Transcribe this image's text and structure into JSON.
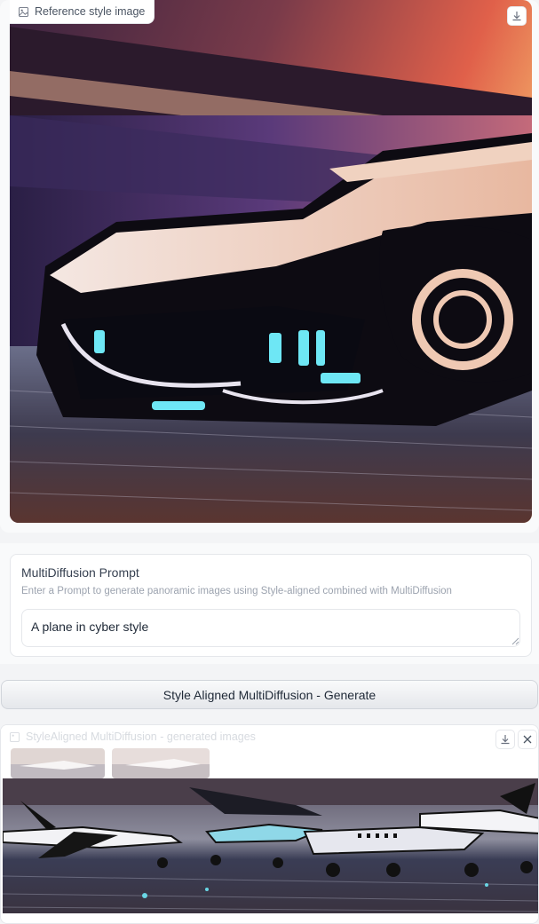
{
  "reference_image": {
    "label": "Reference style image",
    "download_icon": "download-icon"
  },
  "prompt": {
    "label": "MultiDiffusion Prompt",
    "info": "Enter a Prompt to generate panoramic images using Style-aligned combined with MultiDiffusion",
    "value": "A plane in cyber style"
  },
  "generate_button": {
    "label": "Style Aligned MultiDiffusion - Generate"
  },
  "gallery": {
    "label": "StyleAligned MultiDiffusion - generated images",
    "download_icon": "download-icon",
    "close_icon": "close-icon"
  },
  "colors": {
    "accent_cyan": "#6ee7f5",
    "panel_bg": "#ffffff",
    "page_bg": "#f3f4f6"
  }
}
